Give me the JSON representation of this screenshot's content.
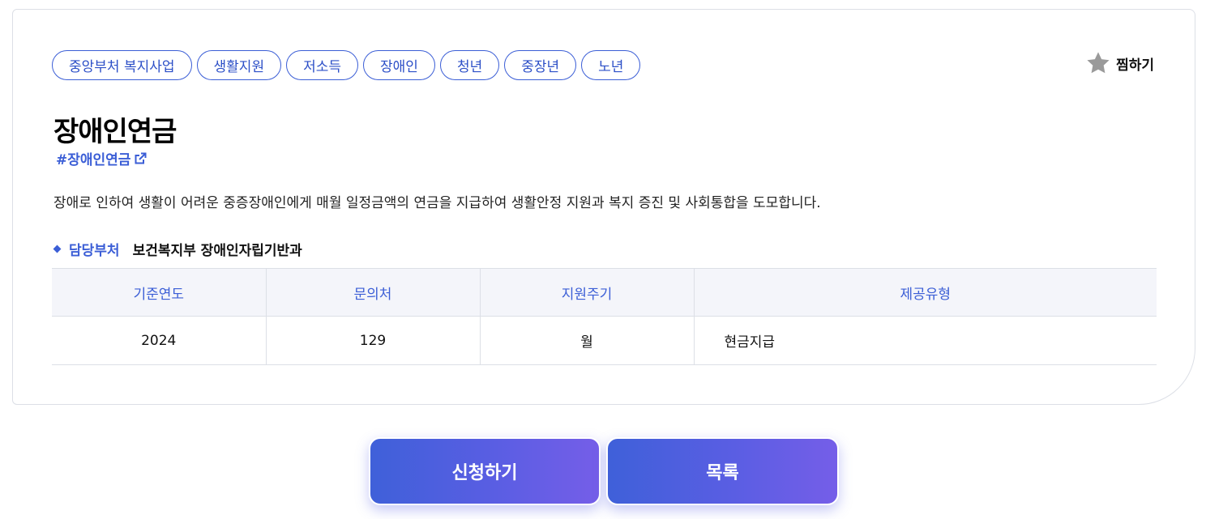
{
  "tags": [
    "중앙부처 복지사업",
    "생활지원",
    "저소득",
    "장애인",
    "청년",
    "중장년",
    "노년"
  ],
  "favorite": {
    "label": "찜하기",
    "icon": "star-icon"
  },
  "title": "장애인연금",
  "hashtag": {
    "label": "#장애인연금",
    "icon": "external-link-icon"
  },
  "description": "장애로 인하여 생활이 어려운 중증장애인에게 매월 일정금액의 연금을 지급하여 생활안정 지원과 복지 증진 및 사회통합을 도모합니다.",
  "department": {
    "label": "담당부처",
    "value": "보건복지부 장애인자립기반과"
  },
  "table": {
    "headers": [
      "기준연도",
      "문의처",
      "지원주기",
      "제공유형"
    ],
    "row": [
      "2024",
      "129",
      "월",
      "현금지급"
    ]
  },
  "buttons": {
    "apply": "신청하기",
    "list": "목록"
  },
  "colors": {
    "accent": "#3b5ed6",
    "button_gradient_start": "#3f60d9",
    "button_gradient_end": "#755ee8",
    "star": "#9a9a9a"
  }
}
